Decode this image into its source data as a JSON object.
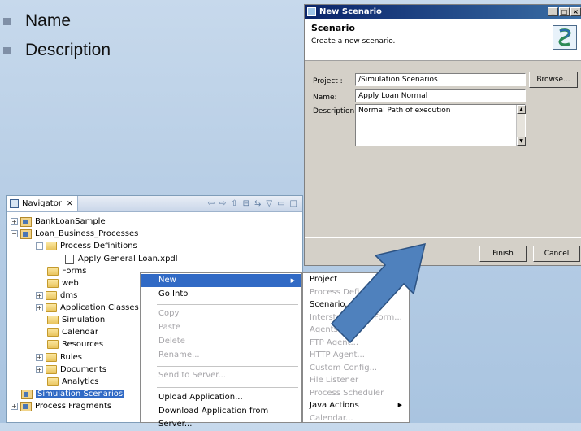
{
  "slide": {
    "bullets": [
      "Name",
      "Description"
    ]
  },
  "dialog": {
    "window_title": "New Scenario",
    "header_title": "Scenario",
    "header_subtitle": "Create a new scenario.",
    "project_label": "Project :",
    "project_value": "/Simulation Scenarios",
    "browse_label": "Browse...",
    "name_label": "Name:",
    "name_value": "Apply Loan Normal",
    "description_label": "Description:",
    "description_value": "Normal Path of execution",
    "finish_label": "Finish",
    "cancel_label": "Cancel"
  },
  "navigator": {
    "tab_label": "Navigator",
    "tree": [
      {
        "label": "BankLoanSample"
      },
      {
        "label": "Loan_Business_Processes"
      },
      {
        "label": "Process Definitions"
      },
      {
        "label": "Apply General Loan.xpdl"
      },
      {
        "label": "Forms"
      },
      {
        "label": "web"
      },
      {
        "label": "dms"
      },
      {
        "label": "Application Classes"
      },
      {
        "label": "Simulation"
      },
      {
        "label": "Calendar"
      },
      {
        "label": "Resources"
      },
      {
        "label": "Rules"
      },
      {
        "label": "Documents"
      },
      {
        "label": "Analytics"
      },
      {
        "label": "Simulation Scenarios"
      },
      {
        "label": "Process Fragments"
      }
    ]
  },
  "context_menu": {
    "items": [
      {
        "label": "New",
        "enabled": true,
        "highlighted": true,
        "submenu": true
      },
      {
        "label": "Go Into",
        "enabled": true
      },
      {
        "label": "Copy",
        "enabled": false
      },
      {
        "label": "Paste",
        "enabled": false
      },
      {
        "label": "Delete",
        "enabled": false
      },
      {
        "label": "Rename...",
        "enabled": false
      },
      {
        "label": "Send to Server...",
        "enabled": false
      },
      {
        "label": "Upload Application...",
        "enabled": true
      },
      {
        "label": "Download Application from Server...",
        "enabled": true
      }
    ]
  },
  "submenu": {
    "items": [
      {
        "label": "Project",
        "enabled": true,
        "submenu": true
      },
      {
        "label": "Process Defi",
        "enabled": false
      },
      {
        "label": "Scenario...",
        "enabled": true
      },
      {
        "label": "Interstage BPM Form...",
        "enabled": false
      },
      {
        "label": "Agents",
        "enabled": false
      },
      {
        "label": "FTP Agent...",
        "enabled": false
      },
      {
        "label": "HTTP Agent...",
        "enabled": false
      },
      {
        "label": "Custom Config...",
        "enabled": false
      },
      {
        "label": "File Listener",
        "enabled": false
      },
      {
        "label": "Process Scheduler",
        "enabled": false
      },
      {
        "label": "Java Actions",
        "enabled": true,
        "submenu": true
      },
      {
        "label": "Calendar...",
        "enabled": false
      }
    ]
  },
  "colors": {
    "selection": "#316ac5",
    "title_bar": "#0a246a",
    "arrow": "#4f81bd"
  },
  "icons": {
    "submenu_arrow": "▶",
    "tree_collapse": "−",
    "tree_expand": "+"
  }
}
